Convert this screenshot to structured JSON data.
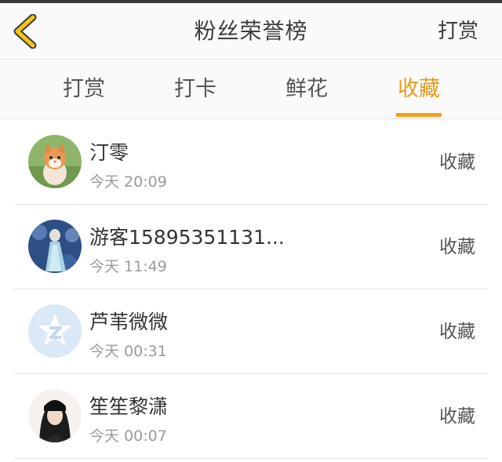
{
  "header": {
    "title": "粉丝荣誉榜",
    "action_label": "打赏",
    "back_icon": "chevron-left-icon"
  },
  "tabs": [
    {
      "label": "打赏",
      "active": false
    },
    {
      "label": "打卡",
      "active": false
    },
    {
      "label": "鲜花",
      "active": false
    },
    {
      "label": "收藏",
      "active": true
    }
  ],
  "colors": {
    "accent": "#f0a020",
    "back_arrow": "#f5c518"
  },
  "list": [
    {
      "name": "汀零",
      "time": "今天 20:09",
      "action": "收藏",
      "avatar": "cat-photo"
    },
    {
      "name": "游客15895351131...",
      "time": "今天 11:49",
      "action": "收藏",
      "avatar": "blue-illustration"
    },
    {
      "name": "芦苇微微",
      "time": "今天 00:31",
      "action": "收藏",
      "avatar": "default-star-logo"
    },
    {
      "name": "笙笙黎潇",
      "time": "今天 00:07",
      "action": "收藏",
      "avatar": "person-photo"
    }
  ]
}
